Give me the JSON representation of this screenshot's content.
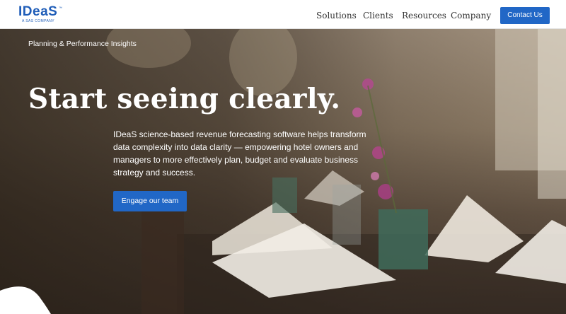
{
  "header": {
    "logo_text": "IDeaS",
    "logo_subtext": "A SAS COMPANY",
    "nav": [
      "Solutions",
      "Clients",
      "Resources",
      "Company"
    ],
    "contact_label": "Contact Us"
  },
  "hero": {
    "eyebrow": "Planning & Performance Insights",
    "title": "Start seeing clearly.",
    "body": "IDeaS science-based revenue forecasting software helps transform data complexity into data clarity — empowering hotel owners and managers to more effectively plan, budget and evaluate business strategy and success.",
    "cta_label": "Engage our team"
  },
  "colors": {
    "brand_blue": "#2167c6",
    "nav_text": "#333333"
  }
}
